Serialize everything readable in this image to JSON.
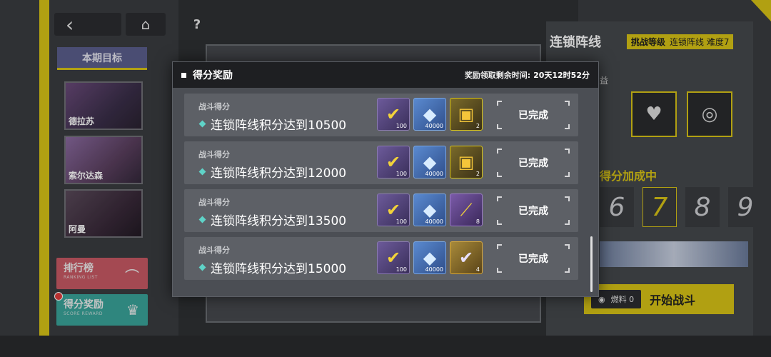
{
  "nav": {
    "back_icon": "‹",
    "home_icon": "⌂",
    "help_icon": "?"
  },
  "sidebar": {
    "goal_title": "本期目标",
    "characters": [
      {
        "name": "德拉苏"
      },
      {
        "name": "索尔达森"
      },
      {
        "name": "阿曼"
      }
    ],
    "ranking": {
      "label": "排行榜",
      "sub": "RANKING LIST"
    },
    "score_reward": {
      "label": "得分奖励",
      "sub": "SCORE REWARD"
    }
  },
  "right_panel": {
    "title": "连锁阵线",
    "challenge_label": "挑战等级",
    "challenge_value": "连锁阵线 难度7",
    "sub_label": "益",
    "bonus_label": "得分加成中",
    "digits": [
      "6",
      "7",
      "8",
      "9"
    ],
    "fuel_label": "燃料 0",
    "start_label": "开始战斗"
  },
  "modal": {
    "title": "得分奖励",
    "timer_label": "奖励领取剩余时间:",
    "timer_value": "20天12时52分",
    "rows": [
      {
        "category": "战斗得分",
        "description": "连锁阵线积分达到10500",
        "status": "已完成",
        "items": [
          {
            "icon": "purple-check-icon",
            "count": "100"
          },
          {
            "icon": "blue-crystal-icon",
            "count": "40000"
          },
          {
            "icon": "gold-box-icon",
            "count": "2"
          }
        ]
      },
      {
        "category": "战斗得分",
        "description": "连锁阵线积分达到12000",
        "status": "已完成",
        "items": [
          {
            "icon": "purple-check-icon",
            "count": "100"
          },
          {
            "icon": "blue-crystal-icon",
            "count": "40000"
          },
          {
            "icon": "gold-box-icon",
            "count": "2"
          }
        ]
      },
      {
        "category": "战斗得分",
        "description": "连锁阵线积分达到13500",
        "status": "已完成",
        "items": [
          {
            "icon": "purple-check-icon",
            "count": "100"
          },
          {
            "icon": "blue-crystal-icon",
            "count": "40000"
          },
          {
            "icon": "violet-sword-icon",
            "count": "8"
          }
        ]
      },
      {
        "category": "战斗得分",
        "description": "连锁阵线积分达到15000",
        "status": "已完成",
        "items": [
          {
            "icon": "purple-check-icon",
            "count": "100"
          },
          {
            "icon": "blue-crystal-icon",
            "count": "40000"
          },
          {
            "icon": "orange-card-icon",
            "count": "4"
          }
        ]
      }
    ]
  },
  "colors": {
    "accent_yellow": "#d8c417",
    "modal_header": "#1e1f22",
    "row_bg": "#5d6066",
    "diamond": "#5fd3c8"
  }
}
